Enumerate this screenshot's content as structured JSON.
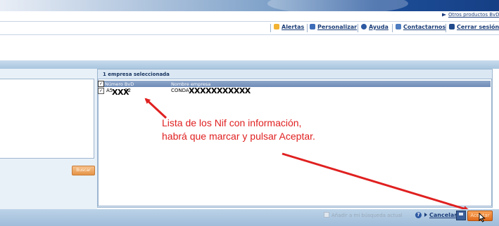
{
  "header": {
    "other_products": "Otros productos BvD",
    "links": [
      {
        "label": "Alertas",
        "icon": "alert-icon"
      },
      {
        "label": "Personalizar",
        "icon": "customize-icon"
      },
      {
        "label": "Ayuda",
        "icon": "help-icon"
      },
      {
        "label": "Contactarnos",
        "icon": "contact-icon"
      },
      {
        "label": "Cerrar sesión",
        "icon": "logout-icon"
      }
    ]
  },
  "left_panel": {
    "search_button": "Buscar"
  },
  "results": {
    "title": "1 empresa seleccionada",
    "columns": [
      "Número BvD",
      "Nombre empresa"
    ],
    "rows": [
      {
        "bvd_visible": "A5",
        "bvd_suffix": "92",
        "bvd_mask": "XXX",
        "name_visible": "CONDA",
        "name_mask": "XXXXXXXXXXX",
        "checked": true
      }
    ]
  },
  "footer": {
    "add_to_search": "Añadir a mi búsqueda actual",
    "cancel": "Cancelar",
    "accept": "Aceptar"
  },
  "annotation": {
    "text": "Lista de los Nif con información, habrá que marcar y pulsar Aceptar.",
    "color": "#e02020"
  },
  "colors": {
    "link": "#1b3d78",
    "accept_button": "#e06a1a",
    "header_row": "#6f8cb8"
  }
}
